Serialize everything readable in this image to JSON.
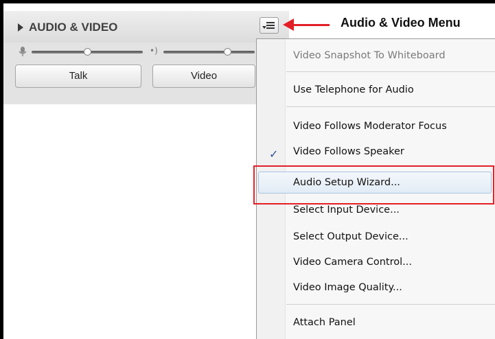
{
  "panel": {
    "title": "AUDIO & VIDEO",
    "talk_label": "Talk",
    "video_label": "Video",
    "mic_level": 0.5,
    "speaker_level": 0.7
  },
  "annotation": {
    "label": "Audio & Video Menu",
    "color": "#e41e26"
  },
  "menu": {
    "items": [
      {
        "label": "Video Snapshot To Whiteboard",
        "enabled": false,
        "checked": false
      },
      {
        "label": "Use Telephone for Audio",
        "enabled": true,
        "checked": false
      },
      {
        "label": "Video Follows Moderator Focus",
        "enabled": true,
        "checked": false
      },
      {
        "label": "Video Follows Speaker",
        "enabled": true,
        "checked": true
      },
      {
        "label": "Audio Setup Wizard...",
        "enabled": true,
        "checked": false,
        "highlighted": true
      },
      {
        "label": "Select Input Device...",
        "enabled": true,
        "checked": false
      },
      {
        "label": "Select Output Device...",
        "enabled": true,
        "checked": false
      },
      {
        "label": "Video Camera Control...",
        "enabled": true,
        "checked": false
      },
      {
        "label": "Video Image Quality...",
        "enabled": true,
        "checked": false
      },
      {
        "label": "Attach Panel",
        "enabled": true,
        "checked": false
      }
    ],
    "check_glyph": "✓"
  }
}
